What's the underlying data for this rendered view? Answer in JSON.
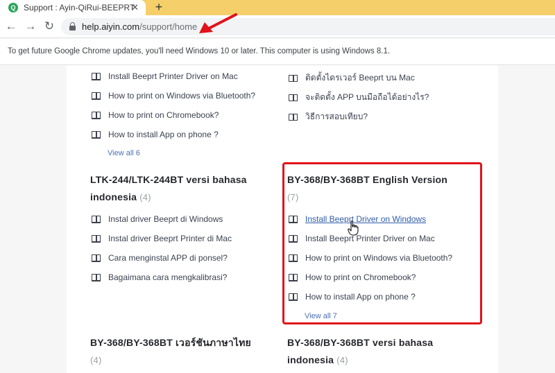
{
  "browser": {
    "tab_title": "Support : Ayin-QiRui-BEEPRT",
    "favicon_letter": "Q",
    "url_host": "help.aiyin.com",
    "url_path": "/support/home",
    "info_message": "To get future Google Chrome updates, you'll need Windows 10 or later. This computer is using Windows 8.1."
  },
  "sections": {
    "top_left": {
      "articles": [
        "Install Beeprt Printer Driver on Mac",
        "How to print on Windows via Bluetooth?",
        "How to print on Chromebook?",
        "How to install App on phone ?"
      ],
      "view_all": "View all 6"
    },
    "top_right": {
      "articles": [
        "ติดตั้งไดรเวอร์ Beeprt บน Mac",
        "จะติดตั้ง APP บนมือถือได้อย่างไร?",
        "วิธีการสอบเทียบ?"
      ]
    },
    "ltk": {
      "title_line1": "LTK-244/LTK-244BT versi bahasa",
      "title_line2": "indonesia",
      "count": "(4)",
      "articles": [
        "Instal driver Beeprt di Windows",
        "Instal driver Beeprt Printer di Mac",
        "Cara menginstal APP di ponsel?",
        "Bagaimana cara mengkalibrasi?"
      ]
    },
    "by368_en": {
      "title": "BY-368/BY-368BT English Version",
      "count": "(7)",
      "articles": [
        "Install Beeprt Driver on Windows",
        "Install Beeprt Printer Driver on Mac",
        "How to print on Windows via Bluetooth?",
        "How to print on Chromebook?",
        "How to install App on phone ?"
      ],
      "view_all": "View all 7"
    },
    "by368_th": {
      "title": "BY-368/BY-368BT เวอร์ชันภาษาไทย",
      "count": "(4)"
    },
    "by368_id": {
      "title_line1": "BY-368/BY-368BT versi bahasa",
      "title_line2": "indonesia",
      "count": "(4)"
    }
  },
  "colors": {
    "tabstrip": "#f5cf6a",
    "highlight": "#e0131b",
    "link": "#4b6fb5"
  }
}
